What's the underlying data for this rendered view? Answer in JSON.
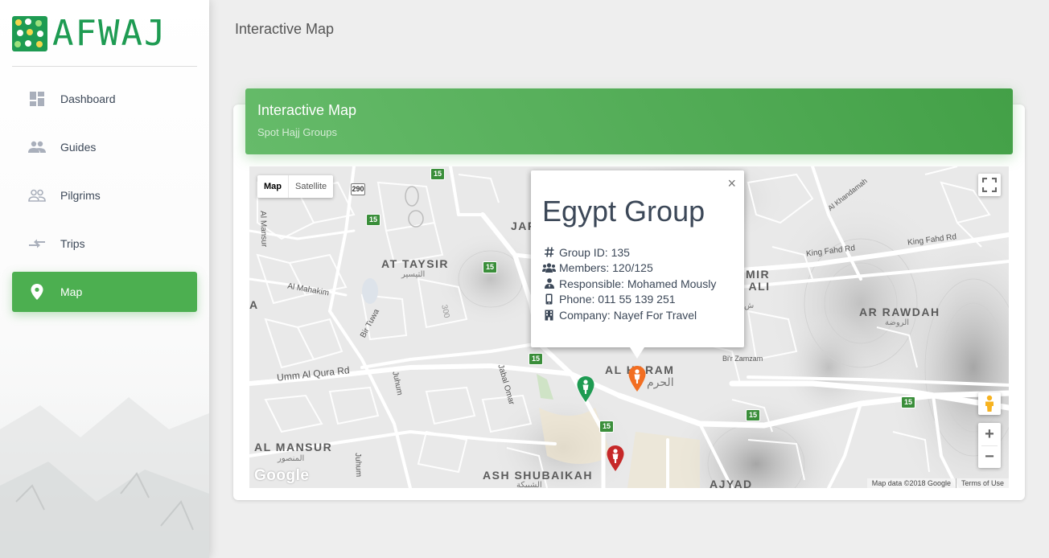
{
  "brand": {
    "name": "AFWAJ",
    "color": "#1e9b52"
  },
  "sidebar": {
    "items": [
      {
        "label": "Dashboard",
        "icon": "dashboard-icon",
        "active": false
      },
      {
        "label": "Guides",
        "icon": "people-icon",
        "active": false
      },
      {
        "label": "Pilgrims",
        "icon": "people-outline-icon",
        "active": false
      },
      {
        "label": "Trips",
        "icon": "compare-arrows-icon",
        "active": false
      },
      {
        "label": "Map",
        "icon": "place-icon",
        "active": true
      }
    ],
    "active_color": "#4caf50"
  },
  "header": {
    "title": "Interactive Map"
  },
  "card": {
    "title": "Interactive Map",
    "subtitle": "Spot Hajj Groups"
  },
  "map": {
    "type_controls": {
      "map": "Map",
      "satellite": "Satellite",
      "selected": "Map"
    },
    "districts": [
      {
        "name": "AT TAYSIR",
        "arabic": "التيسير"
      },
      {
        "name": "AL HARAM",
        "arabic": "الحرم"
      },
      {
        "name": "AR RAWDAH",
        "arabic": "الروضة"
      },
      {
        "name": "AL MANSUR",
        "arabic": "المنصور"
      },
      {
        "name": "ASH SHUBAIKAH",
        "arabic": "الشبيكة"
      },
      {
        "name": "AJYAD",
        "arabic": ""
      }
    ],
    "partial_labels": {
      "left_a": "A",
      "jar": "JAR",
      "amir": "MIR",
      "bali": "B ALI",
      "arabic_partial": "ش"
    },
    "roads": {
      "al_mansur": "Al Mansur",
      "al_mahakim": "Al Mahakim",
      "bir_tuwa": "Bir Tuwa",
      "umm_al_qura": "Umm Al Qura Rd",
      "juhum_1": "Juhum",
      "juhum_2": "Juhum",
      "jabal_omar": "Jabal Omar",
      "king_fahd_1": "King Fahd Rd",
      "king_fahd_2": "King Fahd Rd",
      "al_khandamah": "Al Khandamah",
      "bir_zamzam": "Bi'r Zamzam",
      "road_300": "300"
    },
    "highway_shields": [
      "15",
      "290",
      "15",
      "15",
      "15",
      "15",
      "15",
      "15"
    ],
    "google_logo": "Google",
    "attribution": {
      "data": "Map data ©2018 Google",
      "terms": "Terms of Use"
    },
    "zoom_in": "+",
    "zoom_out": "−",
    "close_symbol": "×",
    "markers": [
      {
        "label": "pilgrim-marker-green",
        "color": "#1e9b52"
      },
      {
        "label": "pilgrim-marker-orange",
        "color": "#f26e22"
      },
      {
        "label": "pilgrim-marker-red",
        "color": "#c62828"
      }
    ]
  },
  "infowindow": {
    "title": "Egypt Group",
    "rows": [
      {
        "icon": "hash-icon",
        "text": "Group ID: 135"
      },
      {
        "icon": "users-icon",
        "text": "Members: 120/125"
      },
      {
        "icon": "user-tie-icon",
        "text": "Responsible: Mohamed Mously"
      },
      {
        "icon": "mobile-icon",
        "text": "Phone: 011 55 139 251"
      },
      {
        "icon": "building-icon",
        "text": "Company: Nayef For Travel"
      }
    ]
  }
}
